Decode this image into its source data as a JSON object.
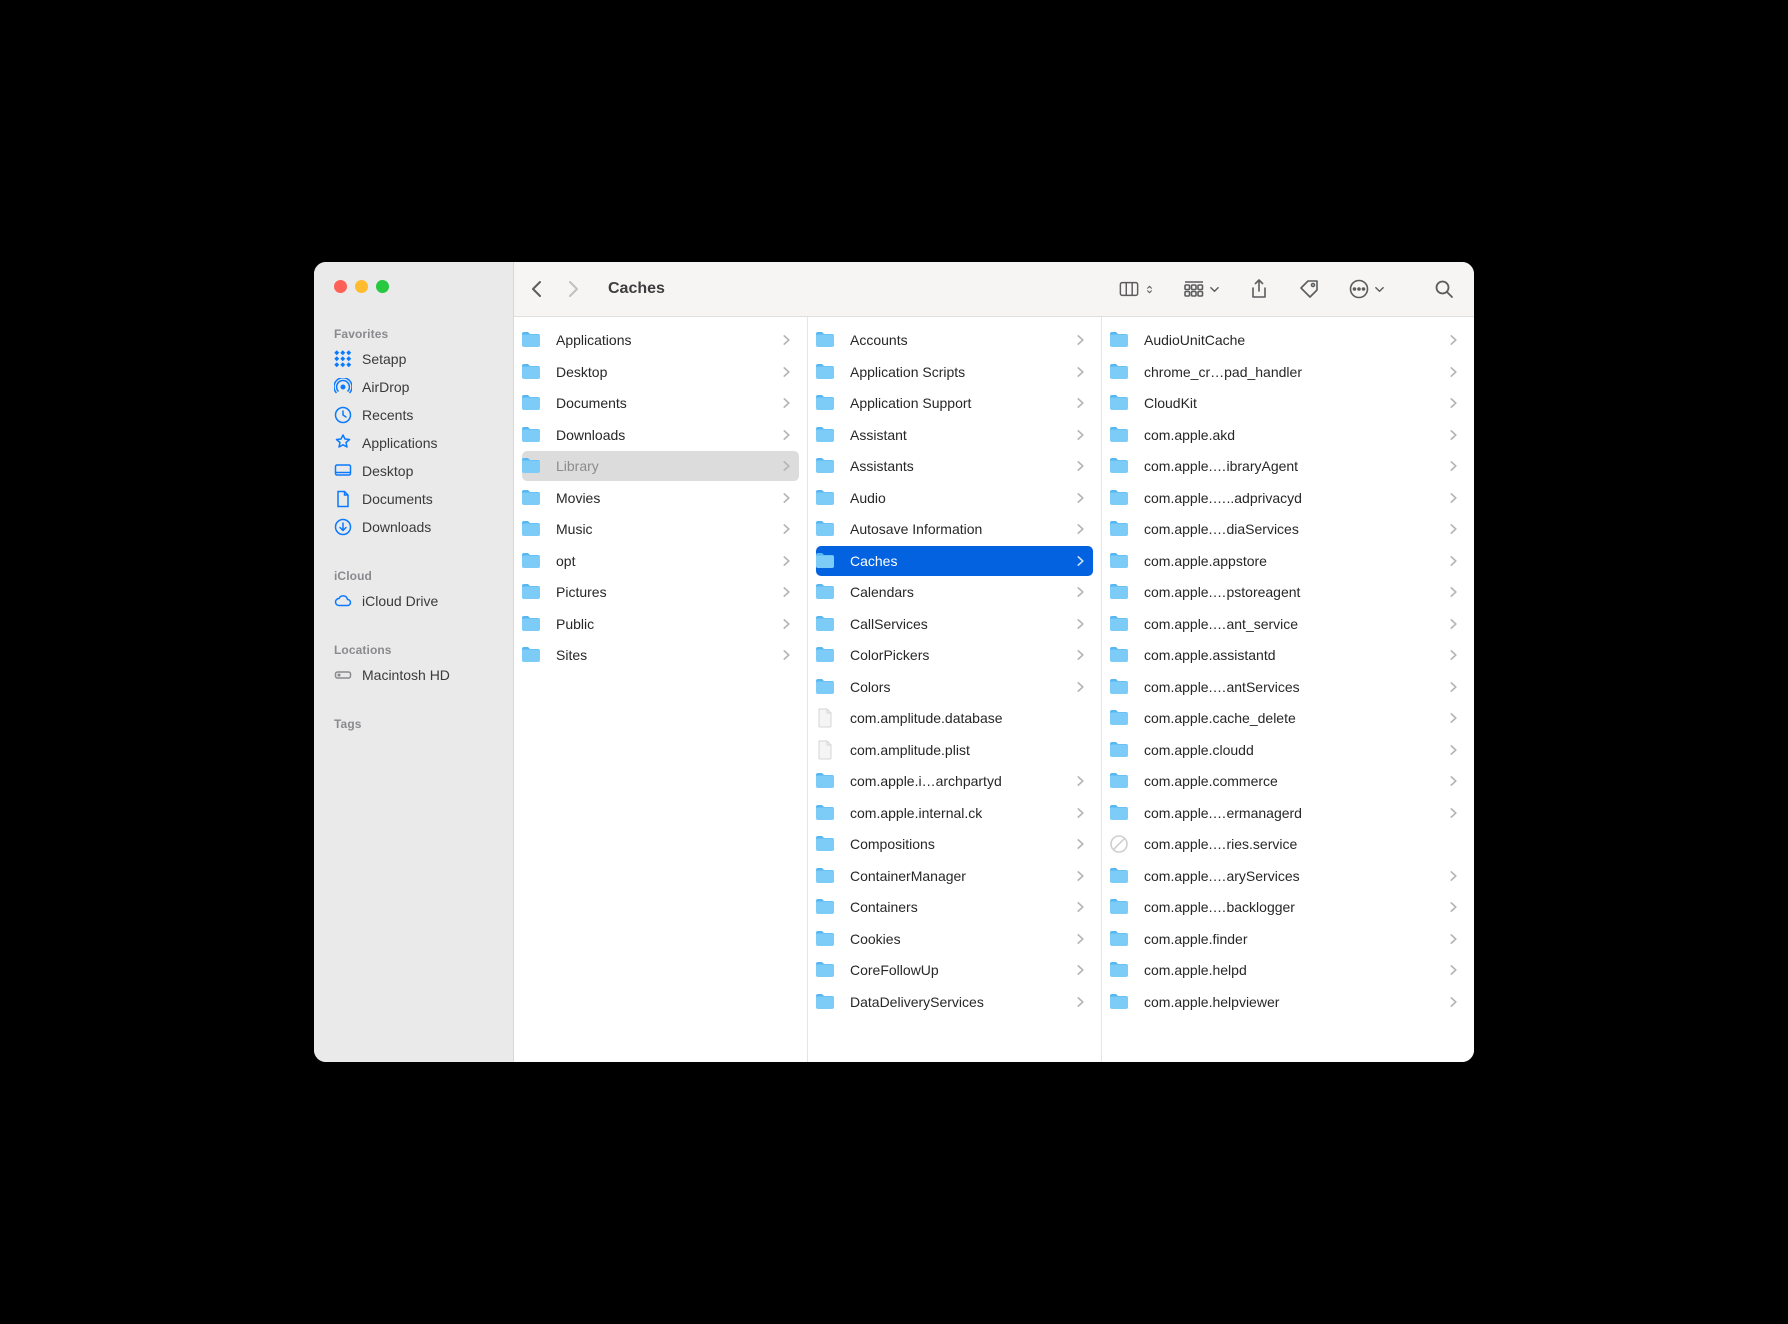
{
  "window_title": "Caches",
  "sidebar": {
    "sections": [
      {
        "label": "Favorites",
        "items": [
          {
            "icon": "grid-dots",
            "label": "Setapp"
          },
          {
            "icon": "airdrop",
            "label": "AirDrop"
          },
          {
            "icon": "clock",
            "label": "Recents"
          },
          {
            "icon": "apps",
            "label": "Applications"
          },
          {
            "icon": "desktop",
            "label": "Desktop"
          },
          {
            "icon": "document",
            "label": "Documents"
          },
          {
            "icon": "download",
            "label": "Downloads"
          }
        ]
      },
      {
        "label": "iCloud",
        "items": [
          {
            "icon": "cloud",
            "label": "iCloud Drive"
          }
        ]
      },
      {
        "label": "Locations",
        "items": [
          {
            "icon": "disk",
            "label": "Macintosh HD"
          }
        ]
      },
      {
        "label": "Tags",
        "items": []
      }
    ]
  },
  "columns": [
    [
      {
        "type": "folder",
        "label": "Applications",
        "hasChildren": true
      },
      {
        "type": "folder",
        "label": "Desktop",
        "hasChildren": true
      },
      {
        "type": "folder",
        "label": "Documents",
        "hasChildren": true
      },
      {
        "type": "folder-download",
        "label": "Downloads",
        "hasChildren": true
      },
      {
        "type": "folder",
        "label": "Library",
        "hasChildren": true,
        "selected": "dim"
      },
      {
        "type": "folder",
        "label": "Movies",
        "hasChildren": true
      },
      {
        "type": "folder-music",
        "label": "Music",
        "hasChildren": true
      },
      {
        "type": "folder",
        "label": "opt",
        "hasChildren": true
      },
      {
        "type": "folder",
        "label": "Pictures",
        "hasChildren": true
      },
      {
        "type": "folder",
        "label": "Public",
        "hasChildren": true
      },
      {
        "type": "folder",
        "label": "Sites",
        "hasChildren": true
      }
    ],
    [
      {
        "type": "folder",
        "label": "Accounts",
        "hasChildren": true
      },
      {
        "type": "folder",
        "label": "Application Scripts",
        "hasChildren": true
      },
      {
        "type": "folder",
        "label": "Application Support",
        "hasChildren": true
      },
      {
        "type": "folder",
        "label": "Assistant",
        "hasChildren": true
      },
      {
        "type": "folder",
        "label": "Assistants",
        "hasChildren": true
      },
      {
        "type": "folder",
        "label": "Audio",
        "hasChildren": true
      },
      {
        "type": "folder",
        "label": "Autosave Information",
        "hasChildren": true
      },
      {
        "type": "folder",
        "label": "Caches",
        "hasChildren": true,
        "selected": "active"
      },
      {
        "type": "folder",
        "label": "Calendars",
        "hasChildren": true
      },
      {
        "type": "folder",
        "label": "CallServices",
        "hasChildren": true
      },
      {
        "type": "folder",
        "label": "ColorPickers",
        "hasChildren": true
      },
      {
        "type": "folder",
        "label": "Colors",
        "hasChildren": true
      },
      {
        "type": "file",
        "label": "com.amplitude.database",
        "hasChildren": false
      },
      {
        "type": "file",
        "label": "com.amplitude.plist",
        "hasChildren": false
      },
      {
        "type": "folder",
        "label": "com.apple.i…archpartyd",
        "hasChildren": true
      },
      {
        "type": "folder",
        "label": "com.apple.internal.ck",
        "hasChildren": true
      },
      {
        "type": "folder",
        "label": "Compositions",
        "hasChildren": true
      },
      {
        "type": "folder",
        "label": "ContainerManager",
        "hasChildren": true
      },
      {
        "type": "folder",
        "label": "Containers",
        "hasChildren": true
      },
      {
        "type": "folder",
        "label": "Cookies",
        "hasChildren": true
      },
      {
        "type": "folder",
        "label": "CoreFollowUp",
        "hasChildren": true
      },
      {
        "type": "folder",
        "label": "DataDeliveryServices",
        "hasChildren": true
      }
    ],
    [
      {
        "type": "folder",
        "label": "AudioUnitCache",
        "hasChildren": true
      },
      {
        "type": "folder",
        "label": "chrome_cr…pad_handler",
        "hasChildren": true
      },
      {
        "type": "folder",
        "label": "CloudKit",
        "hasChildren": true
      },
      {
        "type": "folder",
        "label": "com.apple.akd",
        "hasChildren": true
      },
      {
        "type": "folder",
        "label": "com.apple.…ibraryAgent",
        "hasChildren": true
      },
      {
        "type": "folder",
        "label": "com.apple.…..adprivacyd",
        "hasChildren": true
      },
      {
        "type": "folder",
        "label": "com.apple.…diaServices",
        "hasChildren": true
      },
      {
        "type": "folder",
        "label": "com.apple.appstore",
        "hasChildren": true
      },
      {
        "type": "folder",
        "label": "com.apple.…pstoreagent",
        "hasChildren": true
      },
      {
        "type": "folder",
        "label": "com.apple.…ant_service",
        "hasChildren": true
      },
      {
        "type": "folder",
        "label": "com.apple.assistantd",
        "hasChildren": true
      },
      {
        "type": "folder",
        "label": "com.apple.…antServices",
        "hasChildren": true
      },
      {
        "type": "folder",
        "label": "com.apple.cache_delete",
        "hasChildren": true
      },
      {
        "type": "folder",
        "label": "com.apple.cloudd",
        "hasChildren": true
      },
      {
        "type": "folder",
        "label": "com.apple.commerce",
        "hasChildren": true
      },
      {
        "type": "folder",
        "label": "com.apple.…ermanagerd",
        "hasChildren": true
      },
      {
        "type": "blocked",
        "label": "com.apple.…ries.service",
        "hasChildren": false
      },
      {
        "type": "folder",
        "label": "com.apple.…aryServices",
        "hasChildren": true
      },
      {
        "type": "folder",
        "label": "com.apple.…backlogger",
        "hasChildren": true
      },
      {
        "type": "folder",
        "label": "com.apple.finder",
        "hasChildren": true
      },
      {
        "type": "folder",
        "label": "com.apple.helpd",
        "hasChildren": true
      },
      {
        "type": "folder",
        "label": "com.apple.helpviewer",
        "hasChildren": true
      }
    ]
  ]
}
